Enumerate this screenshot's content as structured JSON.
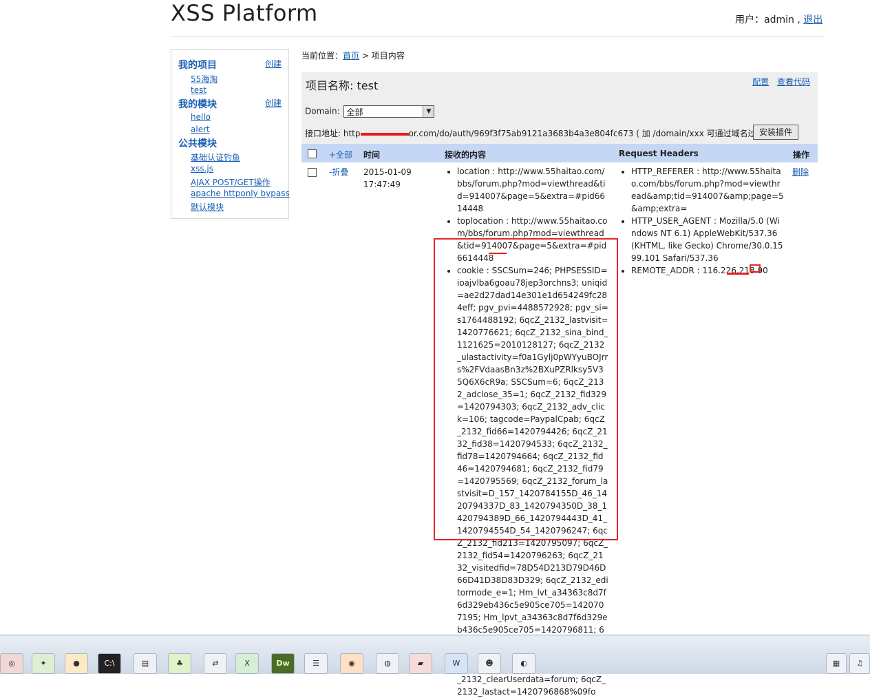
{
  "header": {
    "title": "XSS Platform",
    "user_label": "用户：",
    "username": "admin",
    "separator": ",",
    "logout": "退出"
  },
  "sidebar": {
    "my_projects": "我的项目",
    "create1": "创建",
    "projects": [
      "55海淘",
      "test"
    ],
    "my_modules": "我的模块",
    "create2": "创建",
    "modules": [
      "hello",
      "alert"
    ],
    "public_modules": "公共模块",
    "public_items": [
      "基础认证钓鱼",
      "xss.js",
      "AJAX POST/GET操作",
      "apache httponly bypass",
      "默认模块"
    ]
  },
  "breadcrumb": {
    "label": "当前位置：",
    "home": "首页",
    "sep": " > ",
    "current": "项目内容"
  },
  "project": {
    "name_label": "项目名称: ",
    "name": "test",
    "config": "配置",
    "view_code": "查看代码",
    "domain_label": "Domain:",
    "domain_value": "全部",
    "api_label": "接口地址: http",
    "api_hidden_tail": "or.com/do/auth/969f3f75ab9121a3683b4a3e804fc673 ( 加 /domain/xxx 可通过域名过滤内容)",
    "install_plugin": "安装插件"
  },
  "table": {
    "col_all": "+全部",
    "col_time": "时间",
    "col_content": "接收的内容",
    "col_headers": "Request Headers",
    "col_action": "操作"
  },
  "row": {
    "collapse": "-折叠",
    "date": "2015-01-09",
    "time": "17:47:49",
    "content": [
      "location : http://www.55haitao.com/bbs/forum.php?mod=viewthread&tid=914007&page=5&extra=#pid6614448",
      "toplocation : http://www.55haitao.com/bbs/forum.php?mod=viewthread&tid=914007&page=5&extra=#pid6614448",
      "cookie : SSCSum=246; PHPSESSID=ioajvlba6goau78jep3orchns3; uniqid=ae2d27dad14e301e1d654249fc284eff; pgv_pvi=4488572928; pgv_si=s1764488192; 6qcZ_2132_lastvisit=1420776621; 6qcZ_2132_sina_bind_1121625=2010128127; 6qcZ_2132_ulastactivity=f0a1Gylj0pWYyuBOJrrs%2FVdaasBn3z%2BXuPZRlksy5V35Q6X6cR9a; SSCSum=6; 6qcZ_2132_adclose_35=1; 6qcZ_2132_fid329=1420794303; 6qcZ_2132_adv_click=106; tagcode=PaypalCpab; 6qcZ_2132_fid66=1420794426; 6qcZ_2132_fid38=1420794533; 6qcZ_2132_fid78=1420794664; 6qcZ_2132_fid46=1420794681; 6qcZ_2132_fid79=1420795569; 6qcZ_2132_forum_lastvisit=D_157_1420784155D_46_1420794337D_83_1420794350D_38_1420794389D_66_1420794443D_41_1420794554D_54_1420796247; 6qcZ_2132_fid213=1420795097; 6qcZ_2132_fid54=1420796263; 6qcZ_2132_visitedfid=78D54D213D79D46D66D41D38D83D329; 6qcZ_2132_editormode_e=1; Hm_lvt_a34363c8d7f6d329eb436c5e905ce705=1420707195; Hm_lpvt_a34363c8d7f6d329eb436c5e905ce705=1420796811; 6qcZ_2132_smile=1D1; ae2d27dad14e301e1d654249fc284eff=44d13c06f21738f1e25955f73591d773; 6qcZ_2132_clearUserdata=forum; 6qcZ_2132_lastact=1420796868%09fo"
    ],
    "headers": [
      "HTTP_REFERER : http://www.55haitao.com/bbs/forum.php?mod=viewthread&amp;tid=914007&amp;page=5&amp;extra=",
      "HTTP_USER_AGENT : Mozilla/5.0 (Windows NT 6.1) AppleWebKit/537.36 (KHTML, like Gecko) Chrome/30.0.1599.101 Safari/537.36",
      "REMOTE_ADDR : 116.226.218.90"
    ],
    "delete": "删除"
  },
  "taskbar": {
    "apps": [
      "Dw"
    ]
  },
  "colors": {
    "link": "#1a5fb4",
    "header_row": "#c5d7f5",
    "panel": "#eeeeee",
    "highlight": "#e0282a"
  }
}
